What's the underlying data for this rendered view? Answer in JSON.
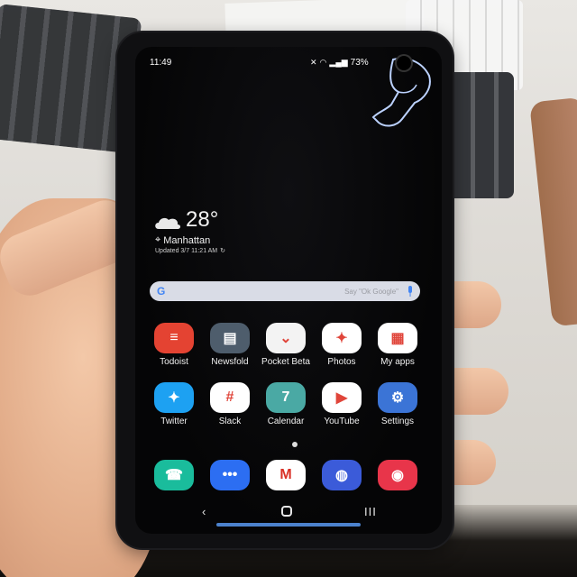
{
  "status_bar": {
    "time": "11:49",
    "battery": "73%",
    "icons": [
      "mute-icon",
      "wifi-icon",
      "signal-icon",
      "battery-icon"
    ]
  },
  "weather": {
    "temperature": "28°",
    "location": "Manhattan",
    "updated": "Updated 3/7 11:21 AM",
    "icon": "partly-cloudy-icon"
  },
  "search": {
    "placeholder": "Say \"Ok Google\"",
    "logo": "G"
  },
  "apps": [
    {
      "label": "Todoist",
      "icon": "todoist-icon",
      "color": "#e44332",
      "glyph": "≡"
    },
    {
      "label": "Newsfold",
      "icon": "newsfold-icon",
      "color": "#4e5d6c",
      "glyph": "▤"
    },
    {
      "label": "Pocket Beta",
      "icon": "pocket-icon",
      "color": "#f3f3f3",
      "glyph": "⌄"
    },
    {
      "label": "Photos",
      "icon": "photos-icon",
      "color": "#ffffff",
      "glyph": "✦"
    },
    {
      "label": "My apps",
      "icon": "my-apps-icon",
      "color": "#ffffff",
      "glyph": "▦"
    },
    {
      "label": "Twitter",
      "icon": "twitter-icon",
      "color": "#1da1f2",
      "glyph": "✦"
    },
    {
      "label": "Slack",
      "icon": "slack-icon",
      "color": "#ffffff",
      "glyph": "#"
    },
    {
      "label": "Calendar",
      "icon": "calendar-icon",
      "color": "#4aa9a4",
      "glyph": "7"
    },
    {
      "label": "YouTube",
      "icon": "youtube-icon",
      "color": "#ffffff",
      "glyph": "▶"
    },
    {
      "label": "Settings",
      "icon": "settings-icon",
      "color": "#3b74d6",
      "glyph": "⚙"
    }
  ],
  "dock": [
    {
      "name": "phone",
      "icon": "phone-icon",
      "color": "#1abc9c",
      "glyph": "☎"
    },
    {
      "name": "messages",
      "icon": "messages-icon",
      "color": "#2c6ef2",
      "glyph": "•••"
    },
    {
      "name": "gmail",
      "icon": "gmail-icon",
      "color": "#ffffff",
      "glyph": "M"
    },
    {
      "name": "internet",
      "icon": "internet-icon",
      "color": "#3b5bd9",
      "glyph": "◍"
    },
    {
      "name": "camera",
      "icon": "camera-icon",
      "color": "#e8354a",
      "glyph": "◉"
    }
  ],
  "nav": {
    "back": "‹",
    "recent": "III"
  }
}
